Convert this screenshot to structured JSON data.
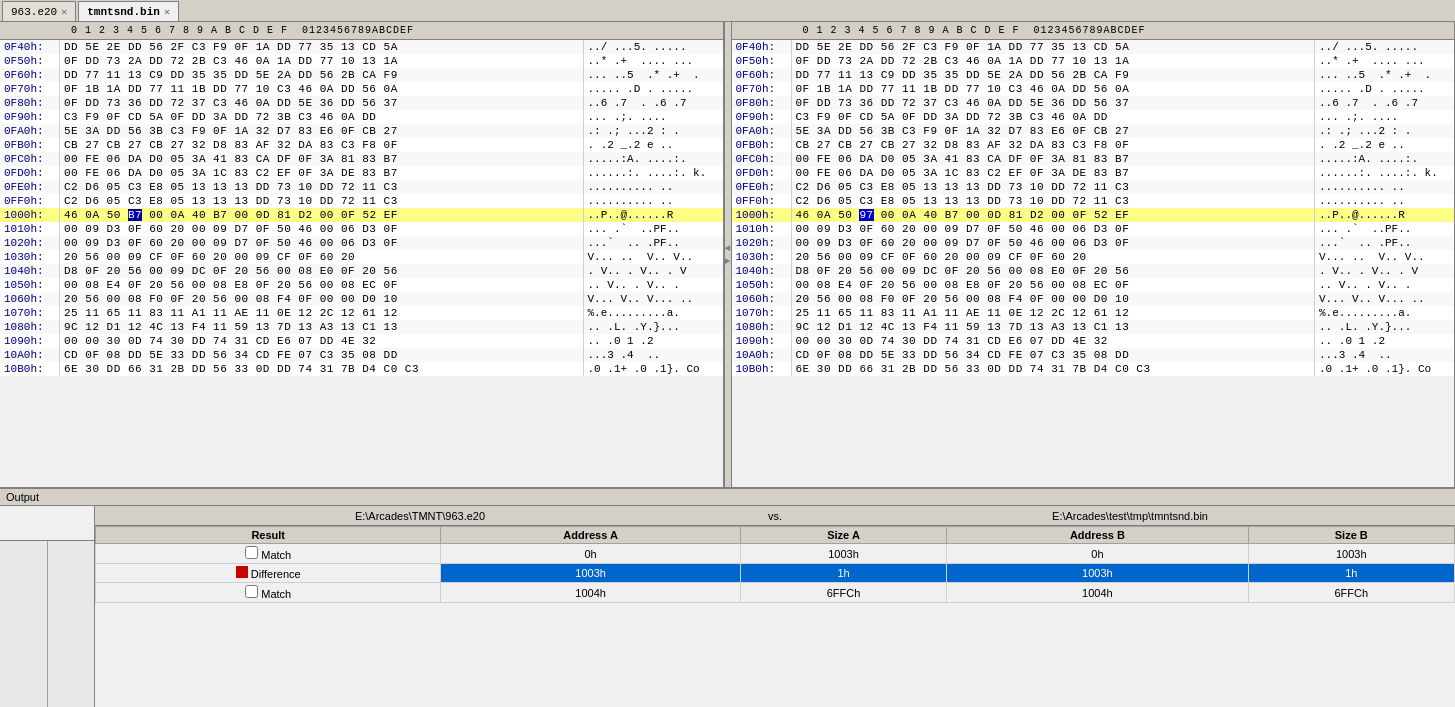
{
  "tabs": [
    {
      "label": "963.e20",
      "active": false,
      "closeable": true
    },
    {
      "label": "tmntsnd.bin",
      "active": true,
      "closeable": true
    }
  ],
  "left_pane": {
    "title": "963.e20",
    "col_header": "  0  1  2  3  4  5  6  7  8  9  A  B  C  D  E  F  0123456789ABCDEF",
    "rows": [
      {
        "addr": "0F40h:",
        "hex": "DD 5E 2E DD 56 2F C3 F9 0F 1A DD 77 35 13 CD 5A",
        "ascii": "../ ...5. ....."
      },
      {
        "addr": "0F50h:",
        "hex": "0F DD 73 2A DD 72 2B C3 46 0A 1A DD 77 10 13 1A",
        "ascii": "..* .+  .... ..."
      },
      {
        "addr": "0F60h:",
        "hex": "DD 77 11 13 C9 DD 35 35 DD 5E 2A DD 56 2B CA F9",
        "ascii": "... ..5  .* .+  ."
      },
      {
        "addr": "0F70h:",
        "hex": "0F 1B 1A DD 77 11 1B DD 77 10 C3 46 0A DD 56 0A",
        "ascii": "..... .D . ..... "
      },
      {
        "addr": "0F80h:",
        "hex": "0F DD 73 36 DD 72 37 C3 46 0A DD 5E 36 DD 56 37",
        "ascii": "..6 .7  . .6 .7"
      },
      {
        "addr": "0F90h:",
        "hex": "C3 F9 0F CD 5A 0F DD 3A DD 72 3B C3 46 0A DD",
        "ascii": "... .;. ...."
      },
      {
        "addr": "0FA0h:",
        "hex": "5E 3A DD 56 3B C3 F9 0F 1A 32 D7 83 E6 0F CB 27",
        "ascii": ".: .; ...2 : ."
      },
      {
        "addr": "0FB0h:",
        "hex": "CB 27 CB 27 CB 27 32 D8 83 AF 32 DA 83 C3 F8 0F",
        "ascii": ". .2 _.2 e .."
      },
      {
        "addr": "0FC0h:",
        "hex": "00 FE 06 DA D0 05 3A 41 83 CA DF 0F 3A 81 83 B7",
        "ascii": ".....:A. ....:."
      },
      {
        "addr": "0FD0h:",
        "hex": "00 FE 06 DA D0 05 3A 1C 83 C2 EF 0F 3A DE 83 B7",
        "ascii": "......:. ....:. k."
      },
      {
        "addr": "0FE0h:",
        "hex": "C2 D6 05 C3 E8 05 13 13 13 DD 73 10 DD 72 11 C3",
        "ascii": ".......... .."
      },
      {
        "addr": "0FF0h:",
        "hex": "C2 D6 05 C3 E8 05 13 13 13 DD 73 10 DD 72 11 C3",
        "ascii": ".......... .."
      },
      {
        "addr": "1000h:",
        "hex": "46 0A 50 B7 00 0A 40 B7 00 0D 81 D2 00 0F 52 EF",
        "ascii": "..P..@......R"
      },
      {
        "addr": "1010h:",
        "hex": "00 09 D3 0F 60 20 00 09 D7 0F 50 46 00 06 D3 0F",
        "ascii": "... .`  ..PF.. "
      },
      {
        "addr": "1020h:",
        "hex": "00 09 D3 0F 60 20 00 09 D7 0F 50 46 00 06 D3 0F",
        "ascii": "...`  .. .PF.."
      },
      {
        "addr": "1030h:",
        "hex": "20 56 00 09 CF 0F 60 20 00 09 CF 0F 60 20",
        "ascii": "V... ..  V.. V.."
      },
      {
        "addr": "1040h:",
        "hex": "D8 0F 20 56 00 09 DC 0F 20 56 00 08 E0 0F 20 56",
        "ascii": ". V.. . V.. . V"
      },
      {
        "addr": "1050h:",
        "hex": "00 08 E4 0F 20 56 00 08 E8 0F 20 56 00 08 EC 0F",
        "ascii": ".. V.. . V.. ."
      },
      {
        "addr": "1060h:",
        "hex": "20 56 00 08 F0 0F 20 56 00 08 F4 0F 00 00 D0 10",
        "ascii": "V... V.. V... .."
      },
      {
        "addr": "1070h:",
        "hex": "25 11 65 11 83 11 A1 11 AE 11 0E 12 2C 12 61 12",
        "ascii": "%.e.........a."
      },
      {
        "addr": "1080h:",
        "hex": "9C 12 D1 12 4C 13 F4 11 59 13 7D 13 A3 13 C1 13",
        "ascii": ".. .L. .Y.}..."
      },
      {
        "addr": "1090h:",
        "hex": "00 00 30 0D 74 30 DD 74 31 CD E6 07 DD 4E 32",
        "ascii": ".. .0 1 .2"
      },
      {
        "addr": "10A0h:",
        "hex": "CD 0F 08 DD 5E 33 DD 56 34 CD FE 07 C3 35 08 DD",
        "ascii": "...3 .4  .."
      },
      {
        "addr": "10B0h:",
        "hex": "6E 30 DD 66 31 2B DD 56 33 0D DD 74 31 7B D4 C0 C3",
        "ascii": ".0 .1+ .0 .1}. Co"
      }
    ]
  },
  "right_pane": {
    "title": "tmntsnd.bin",
    "col_header": "  0  1  2  3  4  5  6  7  8  9  A  B  C  D  E  F  0123456789ABCDEF",
    "rows": [
      {
        "addr": "0F40h:",
        "hex": "DD 5E 2E DD 56 2F C3 F9 0F 1A DD 77 35 13 CD 5A",
        "ascii": "../ ...5. ....."
      },
      {
        "addr": "0F50h:",
        "hex": "0F DD 73 2A DD 72 2B C3 46 0A 1A DD 77 10 13 1A",
        "ascii": "..* .+  .... ..."
      },
      {
        "addr": "0F60h:",
        "hex": "DD 77 11 13 C9 DD 35 35 DD 5E 2A DD 56 2B CA F9",
        "ascii": "... ..5  .* .+  ."
      },
      {
        "addr": "0F70h:",
        "hex": "0F 1B 1A DD 77 11 1B DD 77 10 C3 46 0A DD 56 0A",
        "ascii": "..... .D . ..... "
      },
      {
        "addr": "0F80h:",
        "hex": "0F DD 73 36 DD 72 37 C3 46 0A DD 5E 36 DD 56 37",
        "ascii": "..6 .7  . .6 .7"
      },
      {
        "addr": "0F90h:",
        "hex": "C3 F9 0F CD 5A 0F DD 3A DD 72 3B C3 46 0A DD",
        "ascii": "... .;. ...."
      },
      {
        "addr": "0FA0h:",
        "hex": "5E 3A DD 56 3B C3 F9 0F 1A 32 D7 83 E6 0F CB 27",
        "ascii": ".: .; ...2 : ."
      },
      {
        "addr": "0FB0h:",
        "hex": "CB 27 CB 27 CB 27 32 D8 83 AF 32 DA 83 C3 F8 0F",
        "ascii": ". .2 _.2 e .."
      },
      {
        "addr": "0FC0h:",
        "hex": "00 FE 06 DA D0 05 3A 41 83 CA DF 0F 3A 81 83 B7",
        "ascii": ".....:A. ....:."
      },
      {
        "addr": "0FD0h:",
        "hex": "00 FE 06 DA D0 05 3A 1C 83 C2 EF 0F 3A DE 83 B7",
        "ascii": "......:. ....:. k."
      },
      {
        "addr": "0FE0h:",
        "hex": "C2 D6 05 C3 E8 05 13 13 13 DD 73 10 DD 72 11 C3",
        "ascii": ".......... .."
      },
      {
        "addr": "0FF0h:",
        "hex": "C2 D6 05 C3 E8 05 13 13 13 DD 73 10 DD 72 11 C3",
        "ascii": ".......... .."
      },
      {
        "addr": "1000h:",
        "hex": "46 0A 50 97 00 0A 40 B7 00 0D 81 D2 00 0F 52 EF",
        "ascii": "..P..@......R",
        "has_diff": true
      },
      {
        "addr": "1010h:",
        "hex": "00 09 D3 0F 60 20 00 09 D7 0F 50 46 00 06 D3 0F",
        "ascii": "... .`  ..PF.. "
      },
      {
        "addr": "1020h:",
        "hex": "00 09 D3 0F 60 20 00 09 D7 0F 50 46 00 06 D3 0F",
        "ascii": "...`  .. .PF.."
      },
      {
        "addr": "1030h:",
        "hex": "20 56 00 09 CF 0F 60 20 00 09 CF 0F 60 20",
        "ascii": "V... ..  V.. V.."
      },
      {
        "addr": "1040h:",
        "hex": "D8 0F 20 56 00 09 DC 0F 20 56 00 08 E0 0F 20 56",
        "ascii": ". V.. . V.. . V"
      },
      {
        "addr": "1050h:",
        "hex": "00 08 E4 0F 20 56 00 08 E8 0F 20 56 00 08 EC 0F",
        "ascii": ".. V.. . V.. ."
      },
      {
        "addr": "1060h:",
        "hex": "20 56 00 08 F0 0F 20 56 00 08 F4 0F 00 00 D0 10",
        "ascii": "V... V.. V... .."
      },
      {
        "addr": "1070h:",
        "hex": "25 11 65 11 83 11 A1 11 AE 11 0E 12 2C 12 61 12",
        "ascii": "%.e.........a."
      },
      {
        "addr": "1080h:",
        "hex": "9C 12 D1 12 4C 13 F4 11 59 13 7D 13 A3 13 C1 13",
        "ascii": ".. .L. .Y.}..."
      },
      {
        "addr": "1090h:",
        "hex": "00 00 30 0D 74 30 DD 74 31 CD E6 07 DD 4E 32",
        "ascii": ".. .0 1 .2"
      },
      {
        "addr": "10A0h:",
        "hex": "CD 0F 08 DD 5E 33 DD 56 34 CD FE 07 C3 35 08 DD",
        "ascii": "...3 .4  .."
      },
      {
        "addr": "10B0h:",
        "hex": "6E 30 DD 66 31 2B DD 56 33 0D DD 74 31 7B D4 C0 C3",
        "ascii": ".0 .1+ .0 .1}. Co"
      }
    ]
  },
  "output": {
    "header": "Output",
    "path_left": "E:\\Arcades\\TMNT\\963.e20",
    "path_vs": "vs.",
    "path_right": "E:\\Arcades\\test\\tmp\\tmntsnd.bin",
    "table": {
      "columns": [
        "Result",
        "Address A",
        "Size A",
        "Address B",
        "Size B"
      ],
      "rows": [
        {
          "type": "match",
          "result": "Match",
          "addr_a": "0h",
          "size_a": "1003h",
          "addr_b": "0h",
          "size_b": "1003h"
        },
        {
          "type": "diff",
          "result": "Difference",
          "addr_a": "1003h",
          "size_a": "1h",
          "addr_b": "1003h",
          "size_b": "1h"
        },
        {
          "type": "match",
          "result": "Match",
          "addr_a": "1004h",
          "size_a": "6FFCh",
          "addr_b": "1004h",
          "size_b": "6FFCh"
        }
      ]
    }
  }
}
